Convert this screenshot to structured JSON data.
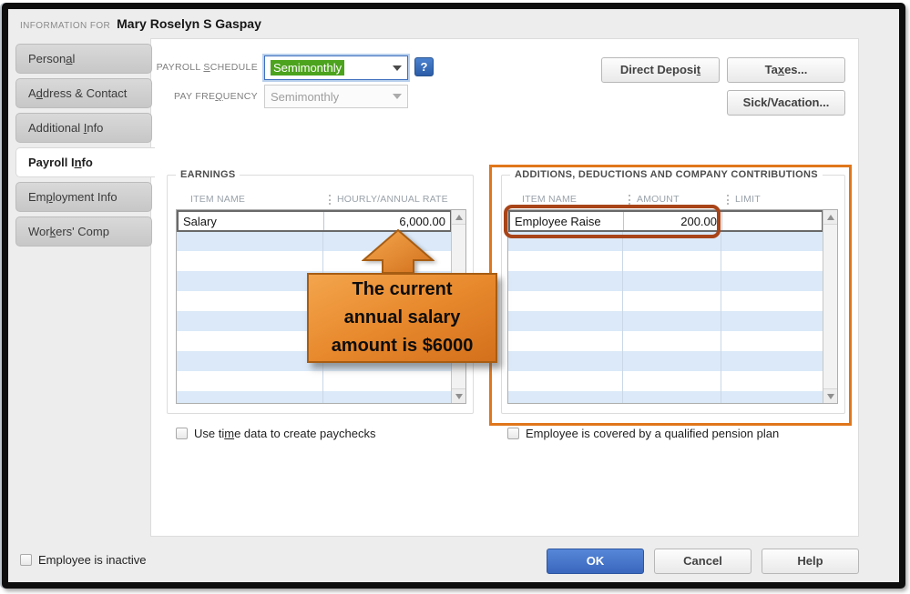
{
  "window": {
    "info_label": "INFORMATION FOR",
    "employee_name": "Mary Roselyn S Gaspay"
  },
  "tabs": [
    {
      "text": "Personal",
      "u": 6,
      "active": false
    },
    {
      "text": "Address & Contact",
      "u": 1,
      "active": false
    },
    {
      "text": "Additional Info",
      "u": 11,
      "active": false
    },
    {
      "text": "Payroll Info",
      "u": 9,
      "active": true
    },
    {
      "text": "Employment Info",
      "u": 2,
      "active": false
    },
    {
      "text": "Workers' Comp",
      "u": 3,
      "active": false
    }
  ],
  "form": {
    "payroll_schedule_label": {
      "text": "PAYROLL SCHEDULE",
      "u": 8
    },
    "payroll_schedule_value": "Semimonthly",
    "pay_frequency_label": {
      "text": "PAY FREQUENCY",
      "u": 7
    },
    "pay_frequency_value": "Semimonthly",
    "help_button": "?"
  },
  "action_buttons": {
    "direct_deposit": {
      "text": "Direct Deposit",
      "u": 13
    },
    "taxes": {
      "text": "Taxes...",
      "u": 2
    },
    "sick_vacation": {
      "text": "Sick/Vacation...",
      "u": -1
    }
  },
  "earnings": {
    "title": "EARNINGS",
    "columns": [
      "ITEM NAME",
      "HOURLY/ANNUAL RATE"
    ],
    "rows": [
      {
        "item_name": "Salary",
        "rate": "6,000.00"
      }
    ]
  },
  "additions": {
    "title": "ADDITIONS, DEDUCTIONS AND COMPANY CONTRIBUTIONS",
    "columns": [
      "ITEM NAME",
      "AMOUNT",
      "LIMIT"
    ],
    "rows": [
      {
        "item_name": "Employee Raise",
        "amount": "200.00",
        "limit": ""
      }
    ]
  },
  "checkboxes": {
    "use_time_data": {
      "label": {
        "text": "Use time data to create paychecks",
        "u": 6
      },
      "checked": false
    },
    "pension_plan": {
      "label": {
        "text": "Employee is covered by a qualified pension plan",
        "u": -1
      },
      "checked": false
    },
    "employee_inactive": {
      "label": {
        "text": "Employee is inactive",
        "u": -1
      },
      "checked": false
    }
  },
  "callout": {
    "text": "The current\nannual salary\namount is $6000"
  },
  "footer_buttons": {
    "ok": "OK",
    "cancel": "Cancel",
    "help": "Help"
  },
  "colors": {
    "annotation_orange": "#E0761B",
    "row_annotation": "#A84418",
    "selection_green": "#4CA31D",
    "primary_blue": "#3A67BD",
    "alt_row_blue": "#DBE9F8"
  }
}
